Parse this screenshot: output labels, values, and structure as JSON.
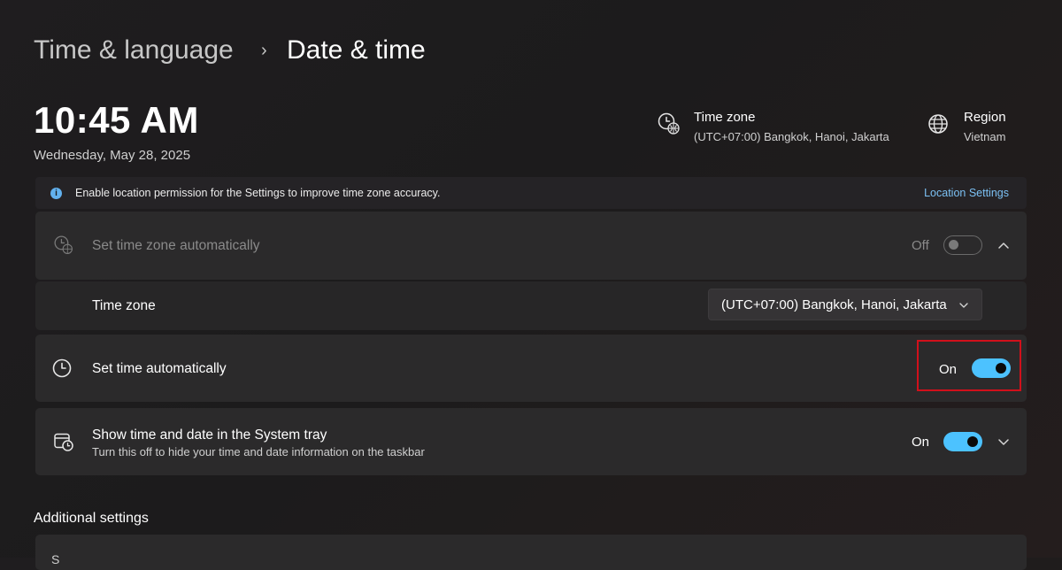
{
  "breadcrumb": {
    "parent": "Time & language",
    "separator": "›",
    "current": "Date & time"
  },
  "clock": {
    "time": "10:45 AM",
    "date": "Wednesday, May 28, 2025"
  },
  "header_info": {
    "timezone": {
      "title": "Time zone",
      "value": "(UTC+07:00) Bangkok, Hanoi, Jakarta",
      "icon": "globe-clock-icon"
    },
    "region": {
      "title": "Region",
      "value": "Vietnam",
      "icon": "globe-icon"
    }
  },
  "banner": {
    "icon_glyph": "i",
    "text": "Enable location permission for the Settings to improve time zone accuracy.",
    "link": "Location Settings"
  },
  "settings": {
    "auto_timezone": {
      "label": "Set time zone automatically",
      "state": "Off",
      "enabled": false,
      "expanded": true
    },
    "timezone_select": {
      "label": "Time zone",
      "value": "(UTC+07:00) Bangkok, Hanoi, Jakarta"
    },
    "auto_time": {
      "label": "Set time automatically",
      "state": "On",
      "enabled": true
    },
    "system_tray": {
      "label": "Show time and date in the System tray",
      "description": "Turn this off to hide your time and date information on the taskbar",
      "state": "On",
      "enabled": true
    }
  },
  "additional": {
    "title": "Additional settings",
    "first_item_partial": "S"
  },
  "colors": {
    "accent": "#4cc2ff",
    "link": "#7cc1f4",
    "highlight_box": "#d1101b",
    "background": "#1e1c1e"
  }
}
